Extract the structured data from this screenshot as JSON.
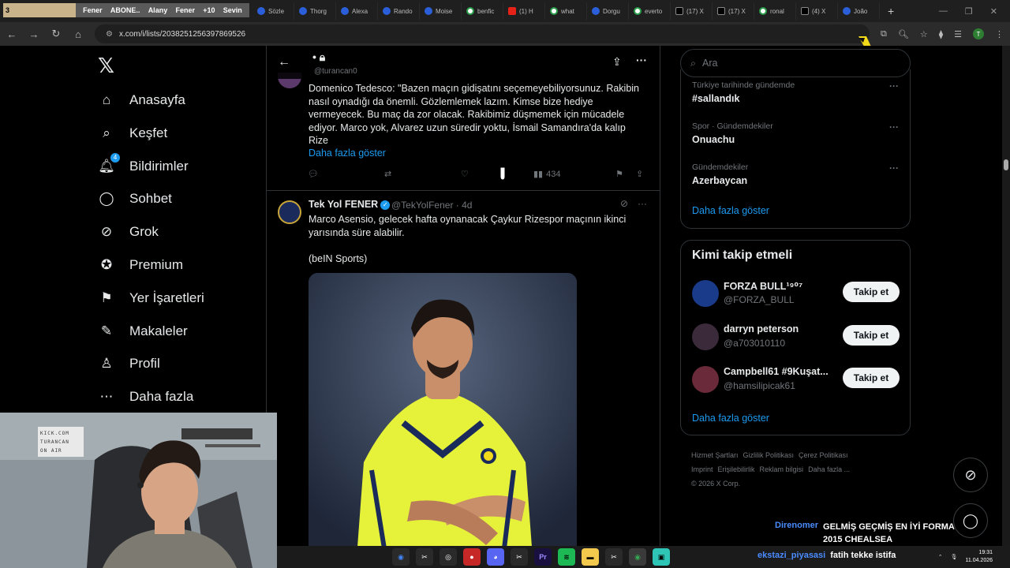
{
  "browser": {
    "overlay_left": "3",
    "overlay_items": [
      "Fener",
      "ABONE..",
      "Alany",
      "Fener",
      "+10",
      "Sevin"
    ],
    "tabs": [
      {
        "label": "Sözle",
        "kind": "blue"
      },
      {
        "label": "Thorg",
        "kind": "blue"
      },
      {
        "label": "Alexa",
        "kind": "blue"
      },
      {
        "label": "Rando",
        "kind": "blue"
      },
      {
        "label": "Moise",
        "kind": "blue"
      },
      {
        "label": "benfic",
        "kind": "g"
      },
      {
        "label": "(1) H",
        "kind": "yt"
      },
      {
        "label": "what",
        "kind": "g"
      },
      {
        "label": "Dorgu",
        "kind": "blue"
      },
      {
        "label": "everto",
        "kind": "g"
      },
      {
        "label": "(17) X",
        "kind": "x"
      },
      {
        "label": "(17) X",
        "kind": "x"
      },
      {
        "label": "ronal",
        "kind": "g"
      },
      {
        "label": "(4) X",
        "kind": "x"
      },
      {
        "label": "João",
        "kind": "blue"
      }
    ],
    "url": "x.com/i/lists/2038251256397869526",
    "profile_initial": "T"
  },
  "nav": {
    "items": [
      {
        "label": "Anasayfa",
        "icon": "home-icon"
      },
      {
        "label": "Keşfet",
        "icon": "search-icon"
      },
      {
        "label": "Bildirimler",
        "icon": "bell-icon",
        "badge": "4"
      },
      {
        "label": "Sohbet",
        "icon": "chat-icon"
      },
      {
        "label": "Grok",
        "icon": "grok-icon"
      },
      {
        "label": "Premium",
        "icon": "premium-icon"
      },
      {
        "label": "Yer İşaretleri",
        "icon": "bookmark-icon"
      },
      {
        "label": "Makaleler",
        "icon": "articles-icon"
      },
      {
        "label": "Profil",
        "icon": "profile-icon"
      },
      {
        "label": "Daha fazla",
        "icon": "more-icon"
      }
    ]
  },
  "header": {
    "handle": "@turancan0"
  },
  "tweet1": {
    "lines": [
      "Domenico Tedesco: \"Bazen maçın gidişatını seçemeyebiliyorsunuz. Rakibin",
      "nasıl oynadığı da önemli. Gözlemlemek lazım. Kimse bize hediye",
      "vermeyecek. Bu maç da zor olacak. Rakibimiz düşmemek için mücadele",
      "ediyor. Marco yok, Alvarez uzun süredir yoktu, İsmail Samandıra'da kalıp",
      "Rize"
    ],
    "show_more": "Daha fazla göster",
    "views": "434"
  },
  "tweet2": {
    "name": "Tek Yol FENER",
    "handle": "@TekYolFener",
    "time": "· 4d",
    "lines": [
      "Marco Asensio, gelecek hafta oynanacak Çaykur Rizespor maçının ikinci",
      "yarısında süre alabilir."
    ],
    "source": "(beIN Sports)"
  },
  "search": {
    "placeholder": "Ara"
  },
  "trends": [
    {
      "category": "Türkiye tarihinde gündemde",
      "name": "#sallandık"
    },
    {
      "category": "Spor · Gündemdekiler",
      "name": "Onuachu"
    },
    {
      "category": "Gündemdekiler",
      "name": "Azerbaycan"
    }
  ],
  "trends_more": "Daha fazla göster",
  "who_to_follow": {
    "title": "Kimi takip etmeli",
    "accounts": [
      {
        "name": "FORZA BULL¹⁹⁰⁷",
        "handle": "@FORZA_BULL",
        "button": "Takip et",
        "color": "#1a3a8a"
      },
      {
        "name": "darryn peterson",
        "handle": "@a703010110",
        "button": "Takip et",
        "color": "#3a2a3a"
      },
      {
        "name": "Campbell61 #9Kuşat...",
        "handle": "@hamsilipicak61",
        "button": "Takip et",
        "color": "#6a2a3a"
      }
    ],
    "more": "Daha fazla göster"
  },
  "footer": [
    "Hizmet Şartları",
    "Gizlilik Politikası",
    "Çerez Politikası",
    "Imprint",
    "Erişilebilirlik",
    "Reklam bilgisi",
    "Daha fazla ...",
    "© 2026 X Corp."
  ],
  "webcam": {
    "sign": [
      "KICK.COM",
      "TURANCAN",
      "ON AIR"
    ]
  },
  "chat": [
    {
      "user": "Direnomer",
      "message": "GELMİŞ GEÇMİŞ EN İYİ FORMA 2015 CHEALSEA"
    },
    {
      "user": "ekstazi_piyasasi",
      "message": "fatih tekke istifa"
    }
  ],
  "taskbar": {
    "time": "19:31",
    "date": "11.04.2026"
  }
}
